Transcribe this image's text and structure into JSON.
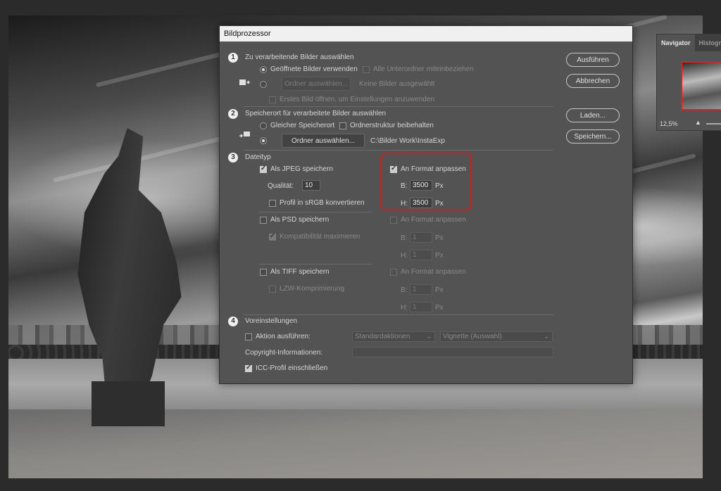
{
  "dialog": {
    "title": "Bildprozessor",
    "buttons": {
      "run": "Ausführen",
      "cancel": "Abbrechen",
      "load": "Laden...",
      "save": "Speichern..."
    },
    "section1": {
      "number": "1",
      "title": "Zu verarbeitende Bilder auswählen",
      "use_open": "Geöffnete Bilder verwenden",
      "include_subfolders": "Alle Unterordner miteinbeziehen",
      "select_folder_btn": "Ordner auswählen...",
      "no_images": "Keine Bilder ausgewählt",
      "open_first": "Erstes Bild öffnen, um Einstellungen anzuwenden"
    },
    "section2": {
      "number": "2",
      "title": "Speicherort für verarbeitete Bilder auswählen",
      "same_location": "Gleicher Speicherort",
      "keep_structure": "Ordnerstruktur beibehalten",
      "select_folder_btn": "Ordner auswählen...",
      "path": "C:\\Bilder Work\\InstaExp"
    },
    "section3": {
      "number": "3",
      "title": "Dateityp",
      "jpeg": {
        "save_as": "Als JPEG speichern",
        "quality_label": "Qualität:",
        "quality_value": "10",
        "srgb": "Profil in sRGB konvertieren",
        "fit": "An Format anpassen",
        "w_label": "B:",
        "w_value": "3500",
        "h_label": "H:",
        "h_value": "3500",
        "unit": "Px"
      },
      "psd": {
        "save_as": "Als PSD speichern",
        "compat": "Kompatibilität maximieren",
        "fit": "An Format anpassen",
        "w_label": "B:",
        "w_value": "1",
        "h_label": "H:",
        "h_value": "1",
        "unit": "Px"
      },
      "tiff": {
        "save_as": "Als TIFF speichern",
        "lzw": "LZW-Komprimierung",
        "fit": "An Format anpassen",
        "w_label": "B:",
        "w_value": "1",
        "h_label": "H:",
        "h_value": "1",
        "unit": "Px"
      }
    },
    "section4": {
      "number": "4",
      "title": "Voreinstellungen",
      "run_action": "Aktion ausführen:",
      "action_set": "Standardaktionen",
      "action": "Vignette (Auswahl)",
      "copyright_label": "Copyright-Informationen:",
      "copyright_value": "",
      "icc": "ICC-Profil einschließen"
    }
  },
  "navigator": {
    "tab_active": "Navigator",
    "tab_other": "Histogr",
    "zoom": "12,5%"
  },
  "colors": {
    "highlight": "#d61a1a",
    "dialog_bg": "#535353"
  }
}
